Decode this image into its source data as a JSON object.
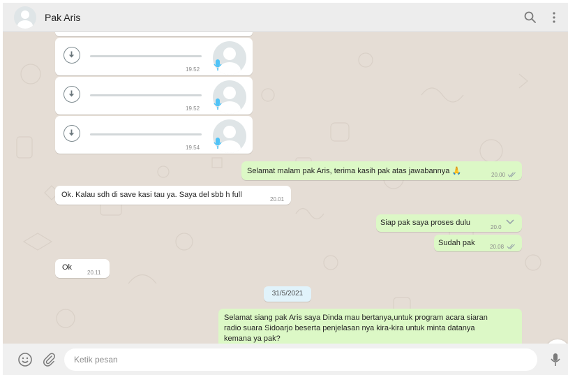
{
  "header": {
    "contact_name": "Pak Aris",
    "icons": [
      "avatar",
      "search-icon",
      "menu-icon"
    ]
  },
  "voice_notes": [
    {
      "time": "19.52"
    },
    {
      "time": "19.52"
    },
    {
      "time": "19.54"
    }
  ],
  "messages": [
    {
      "dir": "out",
      "text": "Selamat malam pak Aris, terima kasih pak atas jawabannya 🙏",
      "time": "20.00",
      "status": "double-check"
    },
    {
      "dir": "in",
      "text": "Ok.  Kalau sdh di save kasi tau ya.  Saya del sbb h full",
      "time": "20.01"
    },
    {
      "dir": "out",
      "text": "Siap pak saya proses dulu",
      "time": "20.0",
      "status": "dropdown"
    },
    {
      "dir": "out",
      "text": "Sudah pak",
      "time": "20.08",
      "status": "double-check"
    },
    {
      "dir": "in",
      "text": "Ok",
      "time": "20.11"
    }
  ],
  "date_divider": "31/5/2021",
  "last_message": {
    "dir": "out",
    "lines": [
      "Selamat siang pak Aris saya Dinda mau  bertanya,untuk program acara siaran",
      "radio suara Sidoarjo beserta penjelasan nya kira-kira untuk minta datanya",
      "kemana ya pak?"
    ]
  },
  "composer": {
    "placeholder": "Ketik pesan",
    "value": ""
  },
  "colors": {
    "chat_background": "#e5ddd5",
    "outgoing_bubble": "#dcf8c6",
    "incoming_bubble": "#ffffff",
    "read_ticks": "#4fc3f7",
    "mic_accent": "#4fc3f7"
  }
}
